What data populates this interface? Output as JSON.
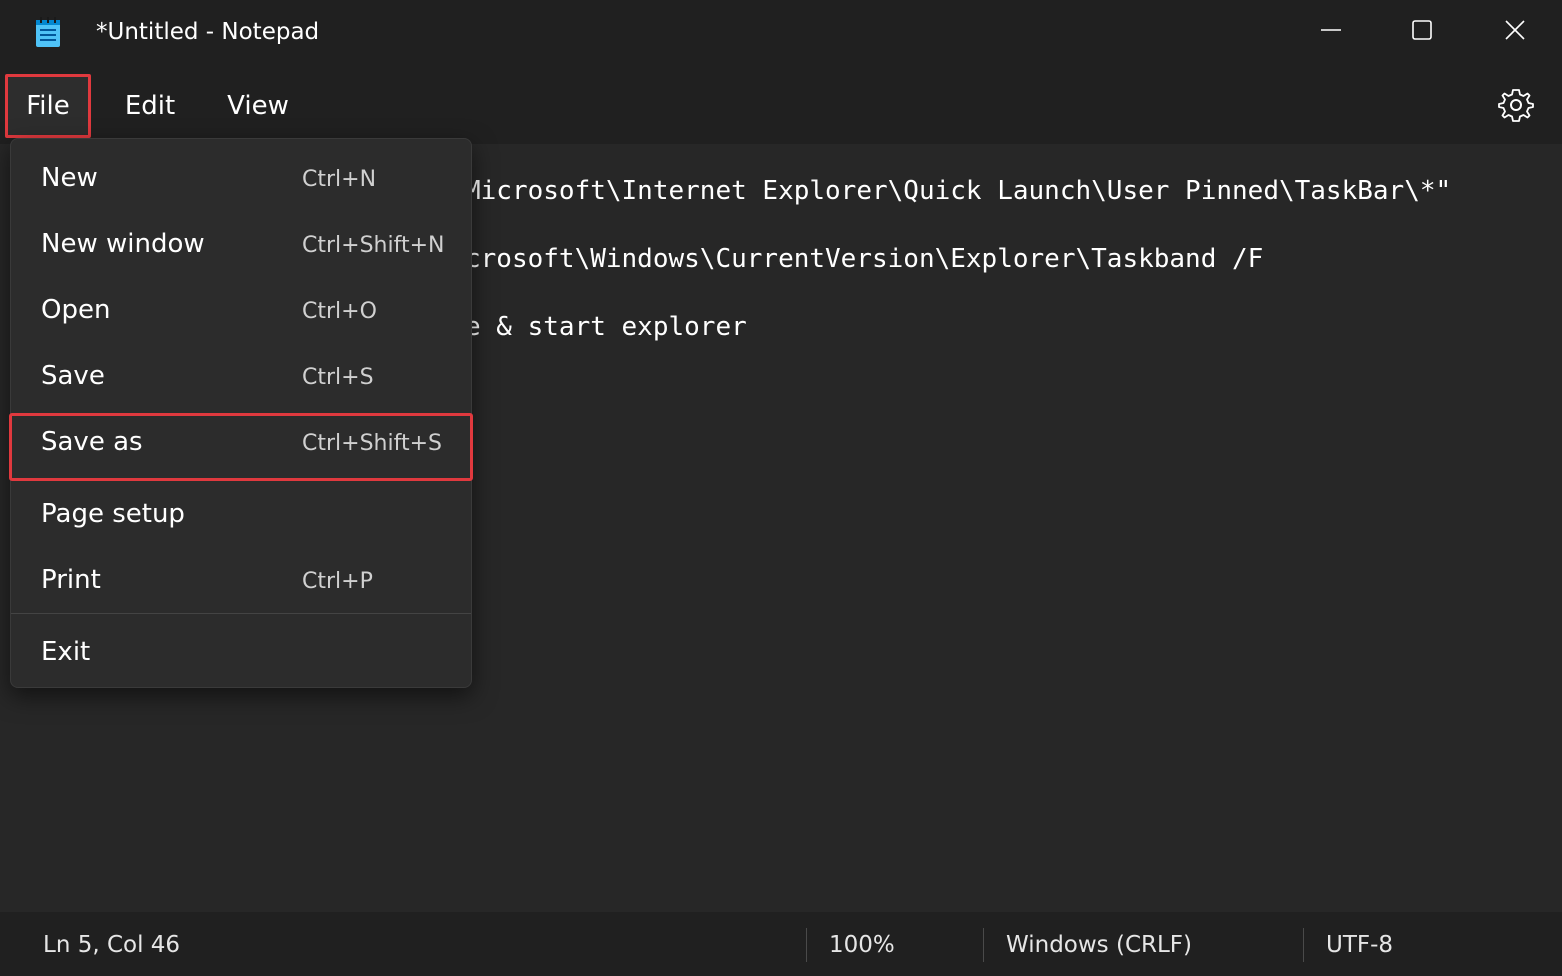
{
  "window": {
    "title": "*Untitled - Notepad",
    "icon": "notepad-icon",
    "controls": [
      "minimize-icon",
      "maximize-icon",
      "close-icon"
    ]
  },
  "menubar": {
    "items": [
      {
        "label": "File"
      },
      {
        "label": "Edit"
      },
      {
        "label": "View"
      }
    ],
    "settings_icon": "gear-icon"
  },
  "file_menu": {
    "items": [
      {
        "label": "New",
        "shortcut": "Ctrl+N"
      },
      {
        "label": "New window",
        "shortcut": "Ctrl+Shift+N"
      },
      {
        "label": "Open",
        "shortcut": "Ctrl+O"
      },
      {
        "label": "Save",
        "shortcut": "Ctrl+S"
      },
      {
        "label": "Save as",
        "shortcut": "Ctrl+Shift+S"
      },
      {
        "label": "Page setup",
        "shortcut": ""
      },
      {
        "label": "Print",
        "shortcut": "Ctrl+P"
      },
      {
        "label": "Exit",
        "shortcut": ""
      }
    ],
    "highlighted": "Save as"
  },
  "editor": {
    "lines": [
      "Microsoft\\Internet Explorer\\Quick Launch\\User Pinned\\TaskBar\\*\"",
      "crosoft\\Windows\\CurrentVersion\\Explorer\\Taskband /F",
      "e & start explorer"
    ]
  },
  "status": {
    "position": "Ln 5, Col 46",
    "zoom": "100%",
    "line_ending": "Windows (CRLF)",
    "encoding": "UTF-8"
  },
  "colors": {
    "background": "#202020",
    "editor": "#272727",
    "menu": "#2c2c2c",
    "highlight_border": "#e0393e"
  }
}
